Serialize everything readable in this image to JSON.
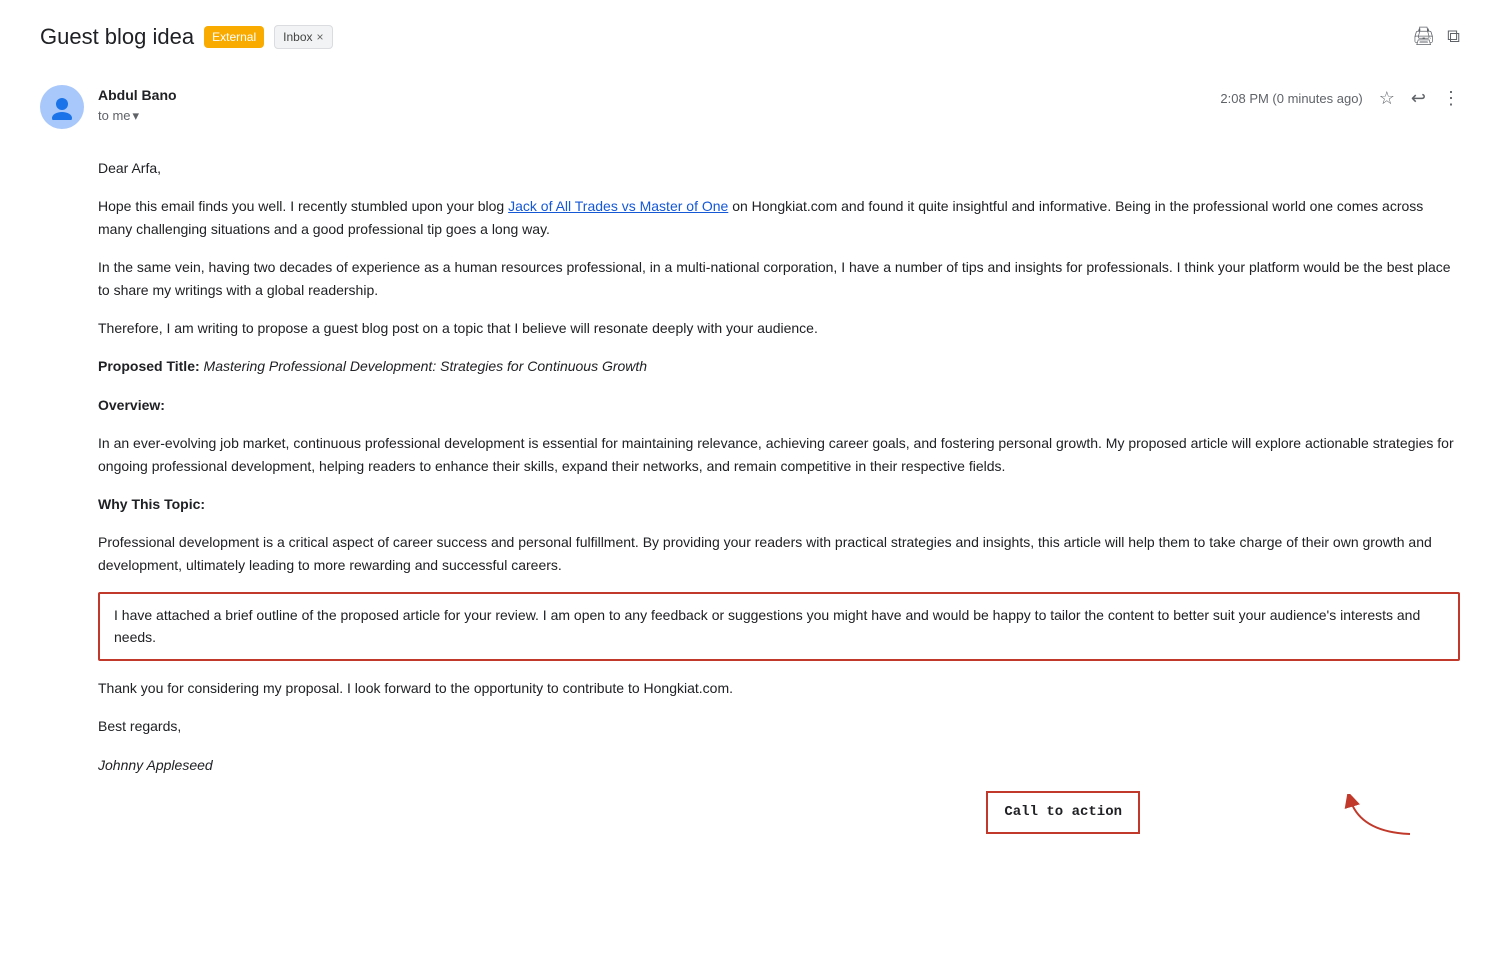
{
  "header": {
    "subject": "Guest blog idea",
    "badge_external": "External",
    "badge_inbox": "Inbox",
    "badge_inbox_close": "×",
    "print_icon": "🖨",
    "openwindow_icon": "⧉"
  },
  "sender": {
    "name": "Abdul Bano",
    "to_label": "to me",
    "dropdown_icon": "▾",
    "timestamp": "2:08 PM (0 minutes ago)",
    "star_icon": "☆",
    "reply_icon": "↩",
    "more_icon": "⋮",
    "avatar_icon": "👤"
  },
  "body": {
    "salutation": "Dear Arfa,",
    "para1_before_link": "Hope this email finds you well. I recently stumbled upon your blog ",
    "para1_link": "Jack of All Trades vs Master of One",
    "para1_after_link": " on Hongkiat.com and found it quite insightful and informative. Being in the professional world one comes across many challenging situations and a good professional tip goes a long way.",
    "para2": "In the same vein, having two decades of experience as a human resources professional, in a multi-national corporation, I have a number of tips and insights for professionals. I think your platform would be the best place to share my writings with a global readership.",
    "para3": "Therefore, I am writing to propose a guest blog post on a topic that I believe will resonate deeply with your audience.",
    "proposed_title_label": "Proposed Title:",
    "proposed_title_value": " Mastering Professional Development: Strategies for Continuous Growth",
    "overview_label": "Overview:",
    "overview_body": "In an ever-evolving job market, continuous professional development is essential for maintaining relevance, achieving career goals, and fostering personal growth. My proposed article will explore actionable strategies for ongoing professional development, helping readers to enhance their skills, expand their networks, and remain competitive in their respective fields.",
    "why_label": "Why This Topic:",
    "why_body": "Professional development is a critical aspect of career success and personal fulfillment. By providing your readers with practical strategies and insights, this article will help them to take charge of their own growth and development, ultimately leading to more rewarding and successful careers.",
    "cta_paragraph": "I have attached a brief outline of the proposed article for your review. I am open to any feedback or suggestions you might have and would be happy to tailor the content to better suit your audience's interests and needs.",
    "closing1": "Thank you for considering my proposal. I look forward to the opportunity to contribute to Hongkiat.com.",
    "closing2": "Best regards,",
    "signature": "Johnny Appleseed",
    "cta_annotation": "Call to action"
  }
}
